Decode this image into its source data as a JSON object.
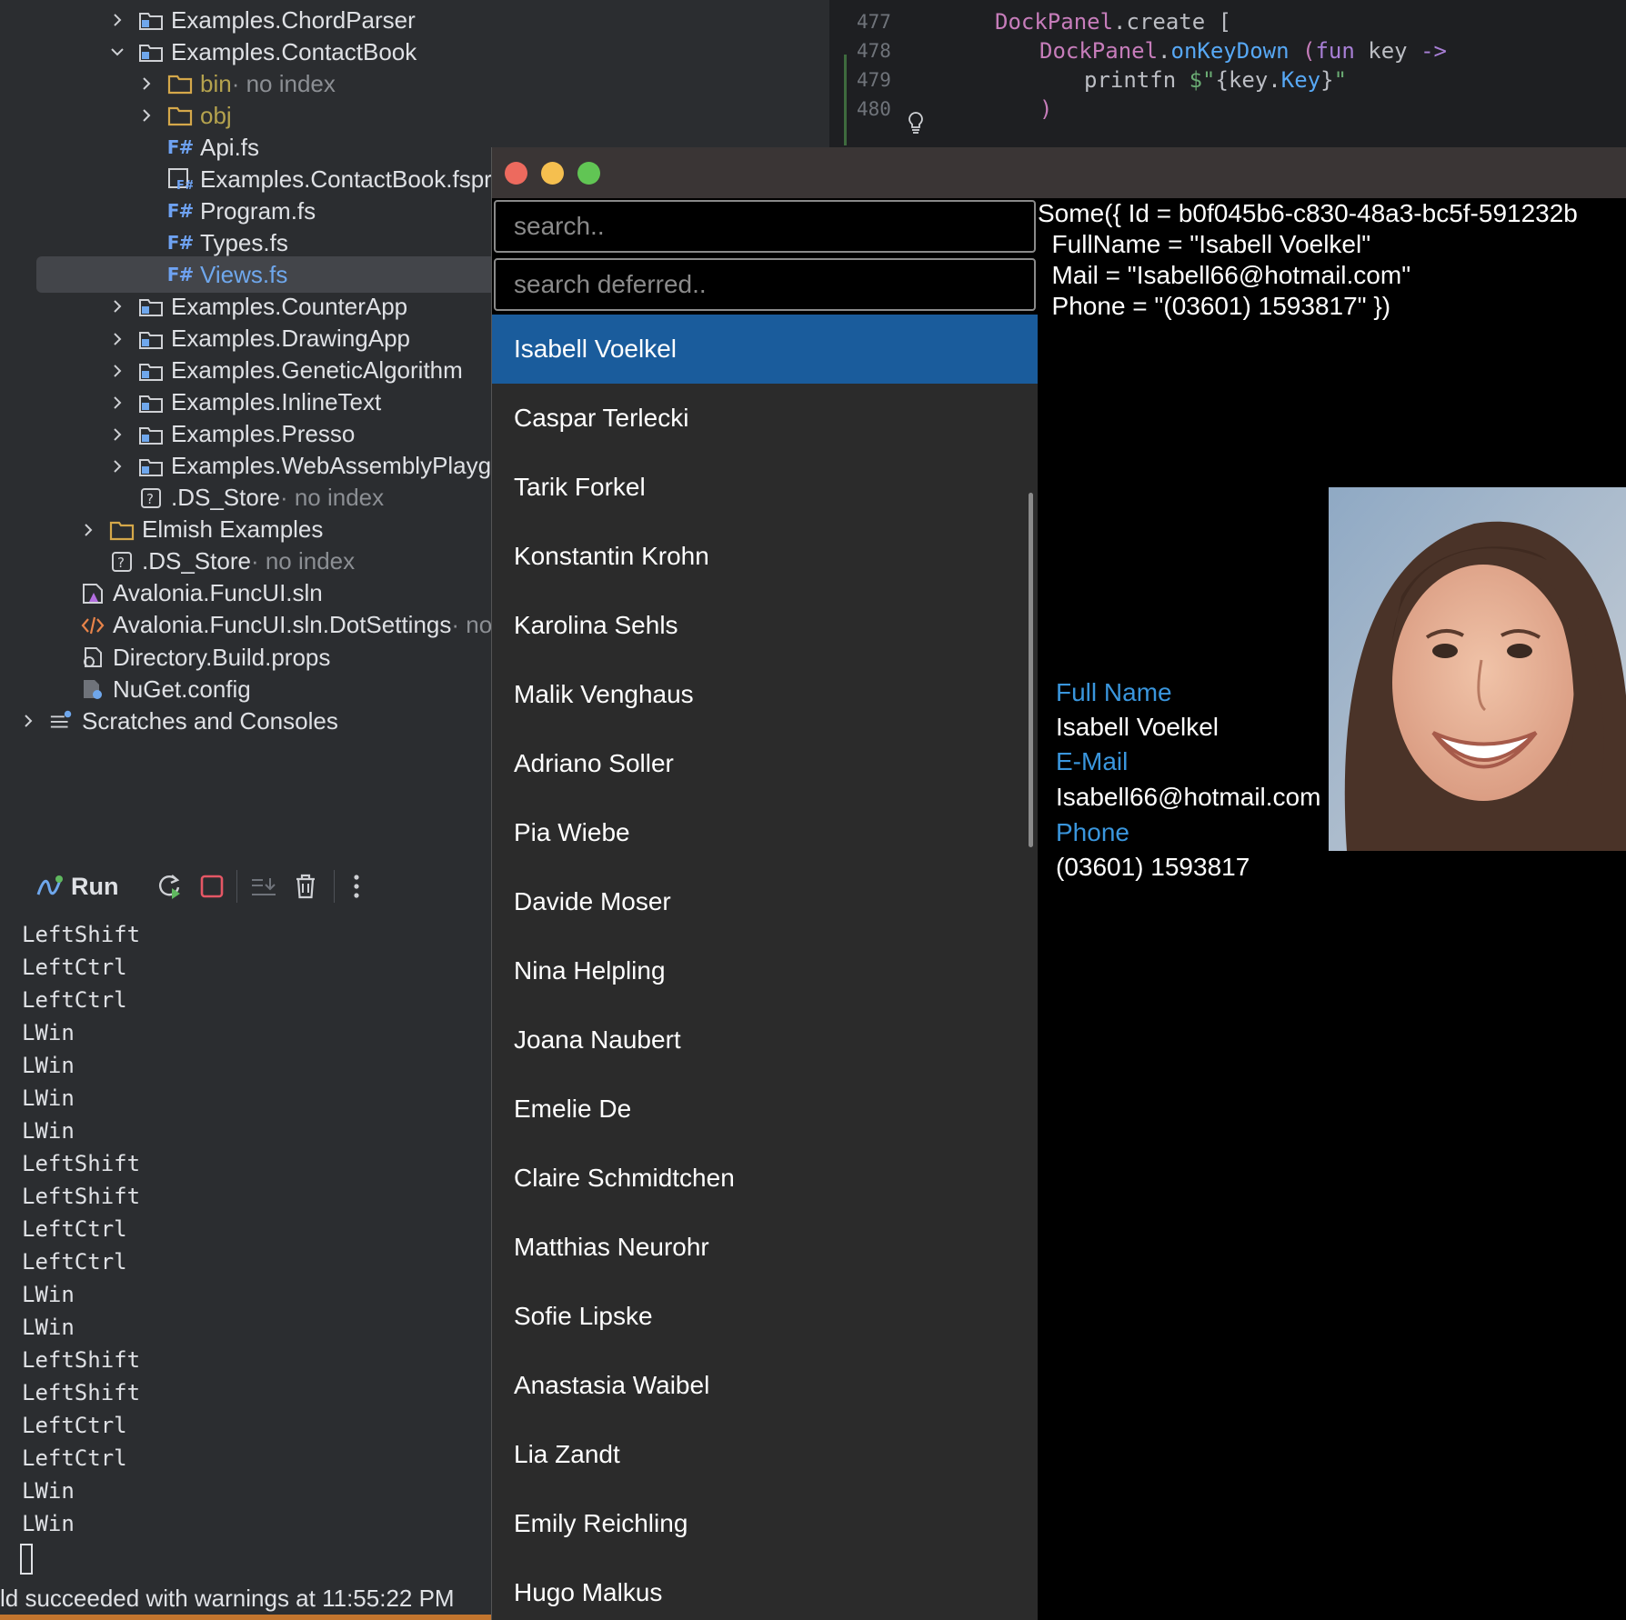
{
  "project_tree": [
    {
      "label": "Examples.ChordParser",
      "suffix": "",
      "indent": 1,
      "expand": "closed",
      "icon": "project-folder-icon",
      "color": "default"
    },
    {
      "label": "Examples.ContactBook",
      "suffix": "",
      "indent": 1,
      "expand": "open",
      "icon": "project-folder-icon",
      "color": "default"
    },
    {
      "label": "bin",
      "suffix": " · no index",
      "indent": 2,
      "expand": "closed",
      "icon": "folder-icon",
      "color": "olive"
    },
    {
      "label": "obj",
      "suffix": "",
      "indent": 2,
      "expand": "closed",
      "icon": "folder-icon",
      "color": "olive"
    },
    {
      "label": "Api.fs",
      "suffix": "",
      "indent": 2,
      "expand": "none",
      "icon": "fsharp-file-icon",
      "color": "default"
    },
    {
      "label": "Examples.ContactBook.fsproj",
      "suffix": "",
      "indent": 2,
      "expand": "none",
      "icon": "fsharp-project-icon",
      "color": "default"
    },
    {
      "label": "Program.fs",
      "suffix": "",
      "indent": 2,
      "expand": "none",
      "icon": "fsharp-file-icon",
      "color": "default"
    },
    {
      "label": "Types.fs",
      "suffix": "",
      "indent": 2,
      "expand": "none",
      "icon": "fsharp-file-icon",
      "color": "default"
    },
    {
      "label": "Views.fs",
      "suffix": "",
      "indent": 2,
      "expand": "none",
      "icon": "fsharp-file-icon",
      "color": "blue",
      "selected": true
    },
    {
      "label": "Examples.CounterApp",
      "suffix": "",
      "indent": 1,
      "expand": "closed",
      "icon": "project-folder-icon",
      "color": "default"
    },
    {
      "label": "Examples.DrawingApp",
      "suffix": "",
      "indent": 1,
      "expand": "closed",
      "icon": "project-folder-icon",
      "color": "default"
    },
    {
      "label": "Examples.GeneticAlgorithm",
      "suffix": "",
      "indent": 1,
      "expand": "closed",
      "icon": "project-folder-icon",
      "color": "default"
    },
    {
      "label": "Examples.InlineText",
      "suffix": "",
      "indent": 1,
      "expand": "closed",
      "icon": "project-folder-icon",
      "color": "default"
    },
    {
      "label": "Examples.Presso",
      "suffix": "",
      "indent": 1,
      "expand": "closed",
      "icon": "project-folder-icon",
      "color": "default"
    },
    {
      "label": "Examples.WebAssemblyPlayground",
      "suffix": "",
      "indent": 1,
      "expand": "closed",
      "icon": "project-folder-icon",
      "color": "default"
    },
    {
      "label": ".DS_Store",
      "suffix": " · no index",
      "indent": 1,
      "expand": "none",
      "icon": "unknown-file-icon",
      "color": "default"
    },
    {
      "label": "Elmish Examples",
      "suffix": "",
      "indent": 0,
      "expand": "closed",
      "icon": "folder-icon",
      "color": "default"
    },
    {
      "label": ".DS_Store",
      "suffix": " · no index",
      "indent": 0,
      "expand": "none",
      "icon": "unknown-file-icon",
      "color": "default"
    },
    {
      "label": "Avalonia.FuncUI.sln",
      "suffix": "",
      "indent": -1,
      "expand": "none",
      "icon": "solution-file-icon",
      "color": "default"
    },
    {
      "label": "Avalonia.FuncUI.sln.DotSettings",
      "suffix": " · no index",
      "indent": -1,
      "expand": "none",
      "icon": "xml-file-icon",
      "color": "default"
    },
    {
      "label": "Directory.Build.props",
      "suffix": "",
      "indent": -1,
      "expand": "none",
      "icon": "props-file-icon",
      "color": "default"
    },
    {
      "label": "NuGet.config",
      "suffix": "",
      "indent": -1,
      "expand": "none",
      "icon": "config-file-icon",
      "color": "default"
    },
    {
      "label": "Scratches and Consoles",
      "suffix": "",
      "indent": -2,
      "expand": "closed",
      "icon": "scratches-icon",
      "color": "default"
    }
  ],
  "editor": {
    "lines": [
      {
        "num": "477",
        "tokens": [
          [
            "ty",
            "DockPanel"
          ],
          [
            "",
            "."
          ],
          [
            "",
            "create "
          ],
          [
            "",
            "["
          ]
        ]
      },
      {
        "num": "478",
        "tokens": [
          [
            "ty",
            "DockPanel"
          ],
          [
            "",
            "."
          ],
          [
            "fn",
            "onKeyDown "
          ],
          [
            "pr",
            "("
          ],
          [
            "kw",
            "fun"
          ],
          [
            "",
            " key "
          ],
          [
            "kw",
            "->"
          ]
        ]
      },
      {
        "num": "479",
        "tokens": [
          [
            "",
            "printfn "
          ],
          [
            "str",
            "$\""
          ],
          [
            "",
            "{key."
          ],
          [
            "fn",
            "Key"
          ],
          [
            "",
            "}"
          ],
          [
            "str",
            "\""
          ]
        ]
      },
      {
        "num": "480",
        "tokens": [
          [
            "pr",
            ")"
          ]
        ]
      }
    ]
  },
  "run": {
    "label": "Run",
    "console_lines": [
      "LeftShift",
      "LeftCtrl",
      "LeftCtrl",
      "LWin",
      "LWin",
      "LWin",
      "LWin",
      "LeftShift",
      "LeftShift",
      "LeftCtrl",
      "LeftCtrl",
      "LWin",
      "LWin",
      "LeftShift",
      "LeftShift",
      "LeftCtrl",
      "LeftCtrl",
      "LWin",
      "LWin"
    ]
  },
  "status": {
    "text": "ld succeeded with warnings at 11:55:22 PM"
  },
  "app": {
    "search_placeholder": "search..",
    "search_deferred_placeholder": "search deferred..",
    "contacts": [
      "Isabell Voelkel",
      "Caspar Terlecki",
      "Tarik Forkel",
      "Konstantin Krohn",
      "Karolina Sehls",
      "Malik Venghaus",
      "Adriano Soller",
      "Pia Wiebe",
      "Davide Moser",
      "Nina Helpling",
      "Joana Naubert",
      "Emelie De",
      "Claire Schmidtchen",
      "Matthias Neurohr",
      "Sofie Lipske",
      "Anastasia Waibel",
      "Lia Zandt",
      "Emily Reichling",
      "Hugo Malkus"
    ],
    "selected_index": 0,
    "record_text": "Some({ Id = b0f045b6-c830-48a3-bc5f-591232b\n  FullName = \"Isabell Voelkel\"\n  Mail = \"Isabell66@hotmail.com\"\n  Phone = \"(03601) 1593817\" })",
    "detail": {
      "fullname_label": "Full Name",
      "fullname": "Isabell Voelkel",
      "email_label": "E-Mail",
      "email": "Isabell66@hotmail.com",
      "phone_label": "Phone",
      "phone": "(03601) 1593817"
    }
  },
  "colors": {
    "accent_blue": "#3a96dd",
    "selection": "#1a5c9c",
    "close": "#ed6a5e",
    "minimize": "#f5bf4f",
    "zoom": "#61c554"
  }
}
